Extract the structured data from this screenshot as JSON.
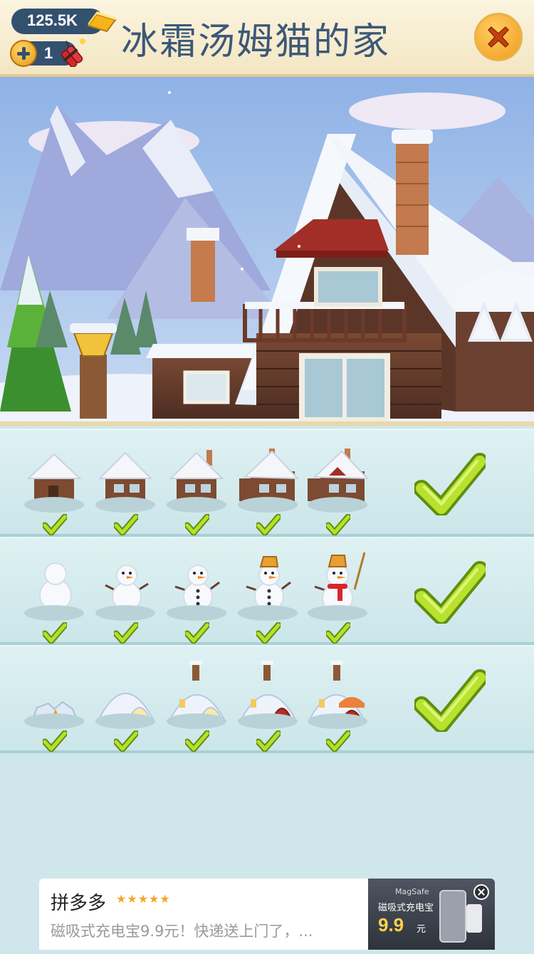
{
  "header": {
    "title": "冰霜汤姆猫的家",
    "gold_amount": "125.5K",
    "dynamite_count": "1",
    "gold_icon": "gold-bar-icon",
    "dynamite_icon": "dynamite-icon",
    "add_icon": "plus-icon",
    "close_icon": "close-icon"
  },
  "scene": {
    "description_icons": [
      "mountain",
      "pine-tree",
      "snow-cabin",
      "chimney",
      "lamp-post"
    ]
  },
  "tasks": [
    {
      "name": "cabin",
      "stages": 5,
      "completed_stages": 5,
      "completed": true
    },
    {
      "name": "snowman",
      "stages": 5,
      "completed_stages": 5,
      "completed": true
    },
    {
      "name": "igloo",
      "stages": 5,
      "completed_stages": 5,
      "completed": true
    }
  ],
  "ad": {
    "brand": "拼多多",
    "stars": "★★★★★",
    "description": "磁吸式充电宝9.9元！快递送上门了，...",
    "image_tag": "MagSafe",
    "image_title": "磁吸式充电宝",
    "price": "9.9",
    "price_unit": "元"
  },
  "colors": {
    "title": "#3c5878",
    "pill": "#33506f",
    "check_green": "#a6d11a",
    "panel_bg": "#cfe7ea"
  }
}
